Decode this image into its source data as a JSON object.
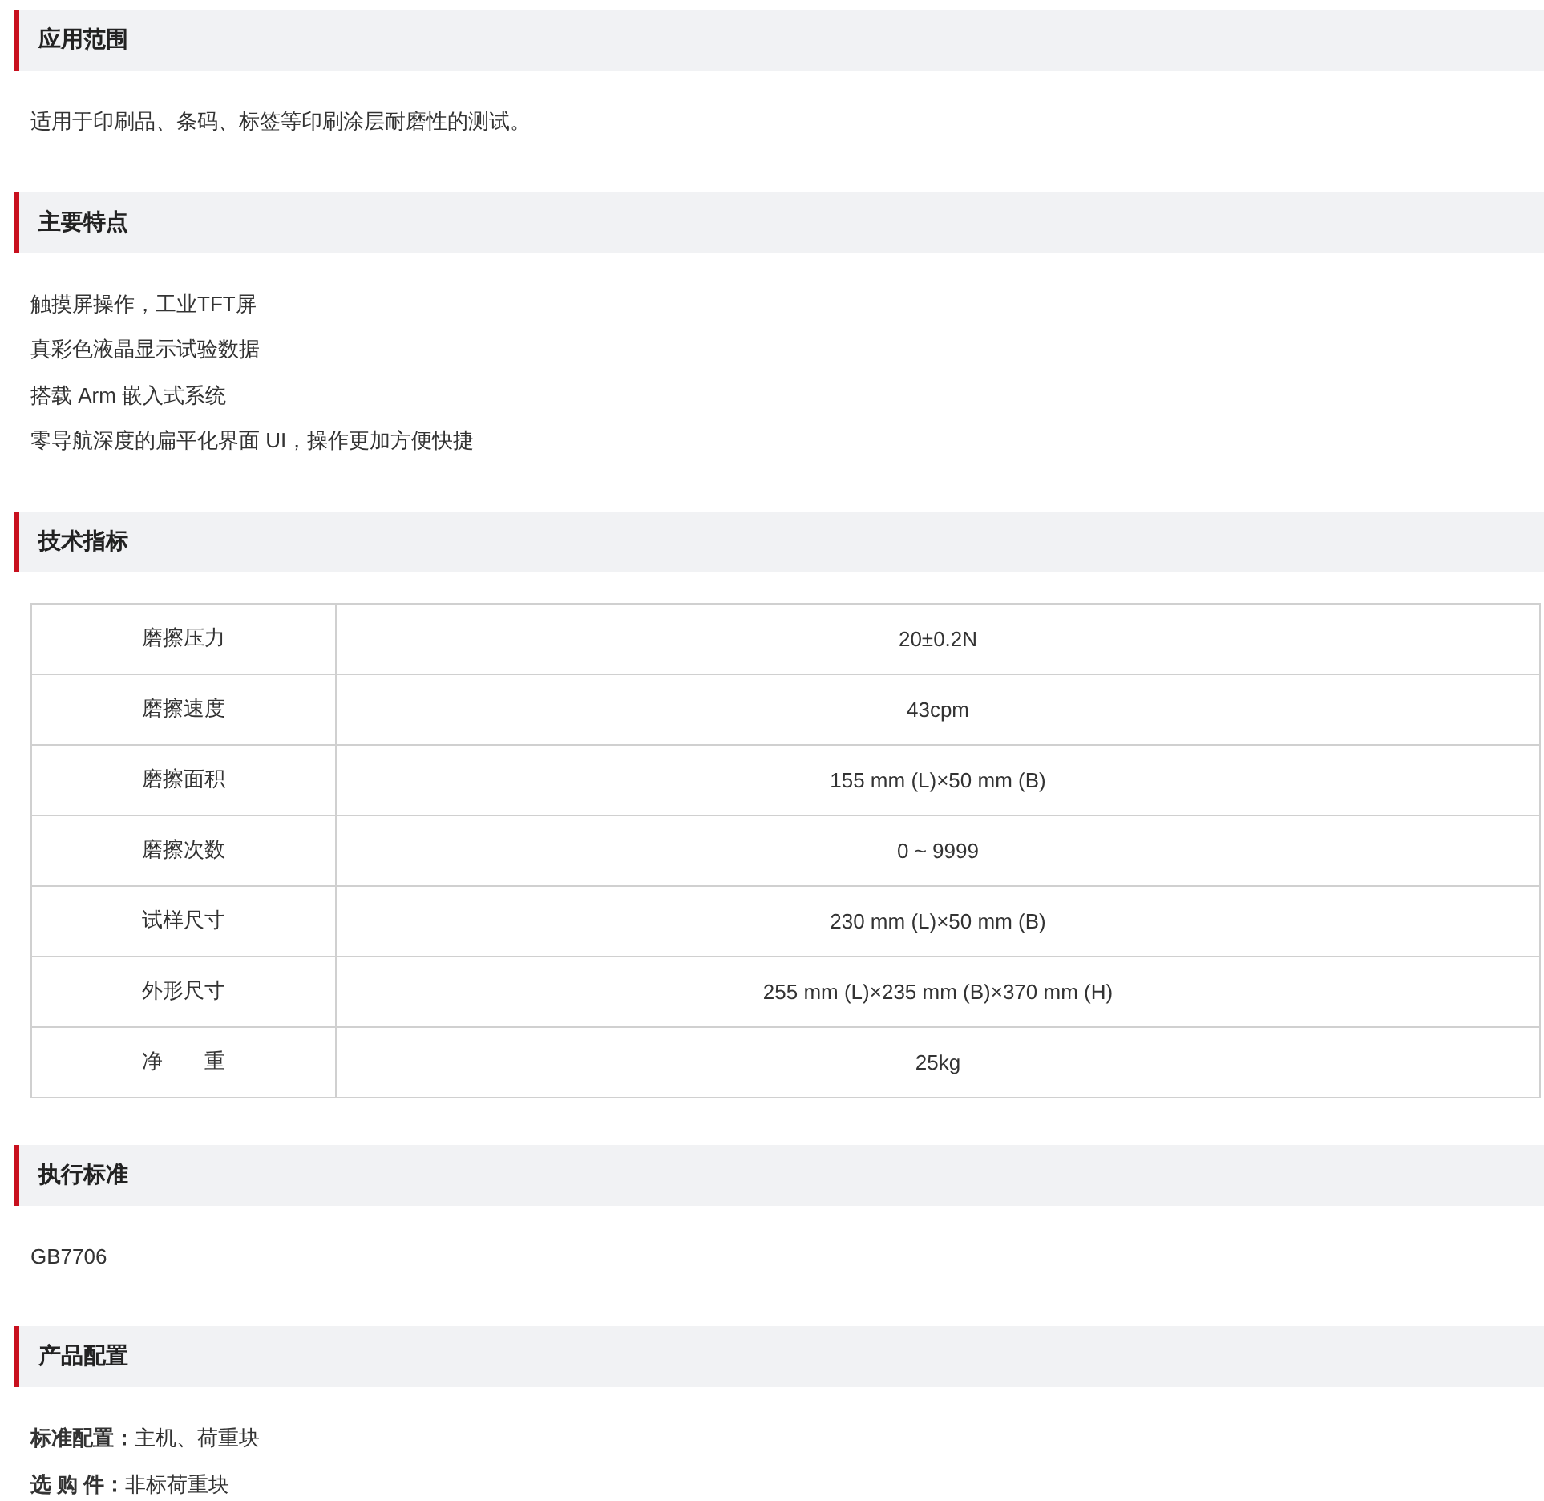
{
  "sections": [
    {
      "title": "应用范围",
      "kind": "paragraph",
      "lines": [
        "适用于印刷品、条码、标签等印刷涂层耐磨性的测试。"
      ]
    },
    {
      "title": "主要特点",
      "kind": "list",
      "lines": [
        "触摸屏操作，工业TFT屏",
        "真彩色液晶显示试验数据",
        "搭载 Arm 嵌入式系统",
        "零导航深度的扁平化界面 UI，操作更加方便快捷"
      ]
    },
    {
      "title": "技术指标",
      "kind": "table",
      "rows": [
        {
          "label": "磨擦压力",
          "value": "20±0.2N"
        },
        {
          "label": "磨擦速度",
          "value": "43cpm"
        },
        {
          "label": "磨擦面积",
          "value": "155 mm (L)×50 mm (B)"
        },
        {
          "label": "磨擦次数",
          "value": "0 ~ 9999"
        },
        {
          "label": "试样尺寸",
          "value": "230 mm (L)×50 mm (B)"
        },
        {
          "label": "外形尺寸",
          "value": "255 mm (L)×235 mm (B)×370 mm (H)"
        },
        {
          "label": "净　　重",
          "value": "25kg"
        }
      ]
    },
    {
      "title": "执行标准",
      "kind": "paragraph",
      "lines": [
        "GB7706"
      ]
    },
    {
      "title": "产品配置",
      "kind": "list",
      "lines": [
        "**标准配置：**主机、荷重块",
        "**选 购 件：**非标荷重块"
      ]
    }
  ]
}
